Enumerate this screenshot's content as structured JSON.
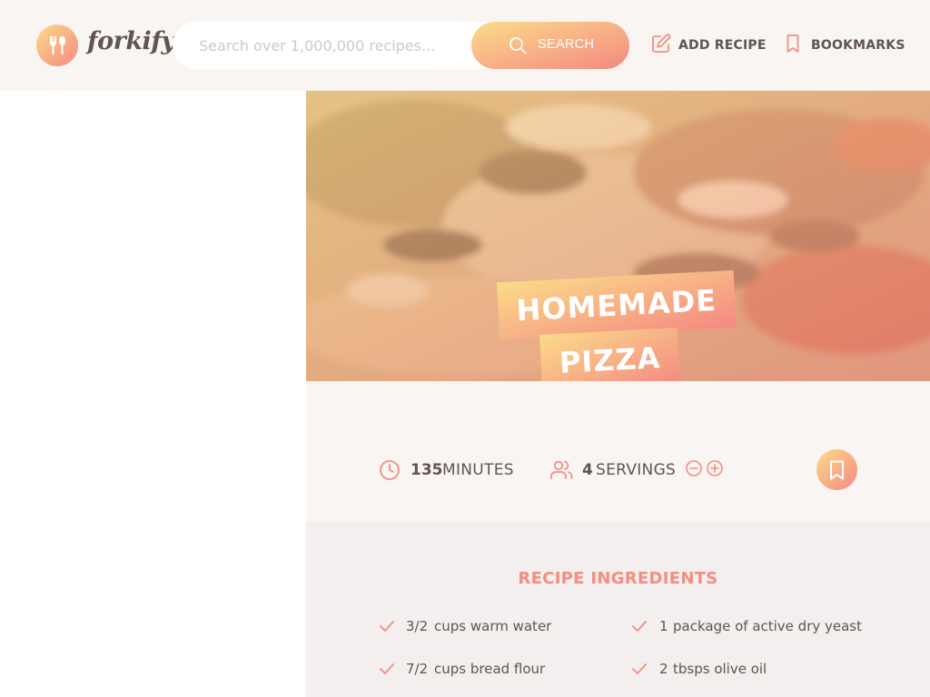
{
  "app": {
    "name": "forkify"
  },
  "search": {
    "placeholder": "Search over 1,000,000 recipes...",
    "value": "",
    "button_label": "SEARCH"
  },
  "nav": {
    "add_recipe": "ADD RECIPE",
    "bookmarks": "BOOKMARKS"
  },
  "recipe": {
    "title_lines": [
      "HOMEMADE",
      "PIZZA"
    ],
    "cooking_time": "135",
    "cooking_time_unit": "MINUTES",
    "servings": "4",
    "servings_unit": "SERVINGS",
    "bookmarked": false
  },
  "ingredients": {
    "heading": "RECIPE INGREDIENTS",
    "items": [
      {
        "quantity": "3/2",
        "description": "cups warm water"
      },
      {
        "quantity": "1",
        "description": "package of active dry yeast"
      },
      {
        "quantity": "7/2",
        "description": "cups bread flour"
      },
      {
        "quantity": "2",
        "description": "tbsps olive oil"
      }
    ]
  },
  "colors": {
    "accent_start": "#fbdb89",
    "accent_end": "#f48982",
    "text": "#615551",
    "heading": "#f38e82"
  },
  "icons": {
    "logo": "fork-spoon-icon",
    "search": "search-icon",
    "add_recipe": "edit-icon",
    "bookmarks": "bookmark-icon",
    "time": "clock-icon",
    "servings": "users-icon",
    "decrease": "minus-circle-icon",
    "increase": "plus-circle-icon",
    "ingredient": "check-icon"
  }
}
